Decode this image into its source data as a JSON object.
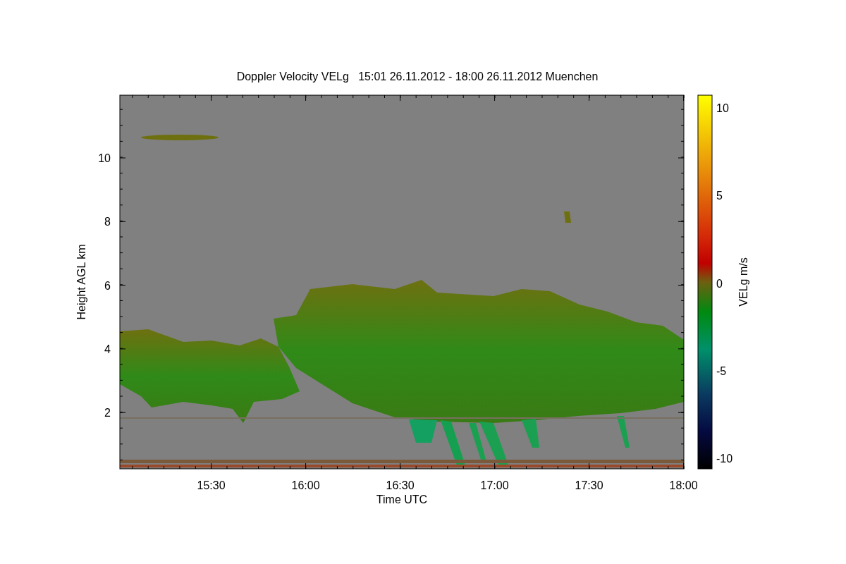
{
  "title": "Doppler Velocity VELg   15:01 26.11.2012 - 18:00 26.11.2012 Muenchen",
  "plot": {
    "xlabel": "Time UTC",
    "ylabel": "Height AGL km",
    "xtick_labels": [
      "15:30",
      "16:00",
      "16:30",
      "17:00",
      "17:30",
      "18:00"
    ],
    "ytick_labels": [
      "10",
      "8",
      "6",
      "4",
      "2"
    ]
  },
  "colorbar": {
    "label": "VELg m/s",
    "tick_labels": [
      "10",
      "5",
      "0",
      "-5",
      "-10"
    ]
  }
}
